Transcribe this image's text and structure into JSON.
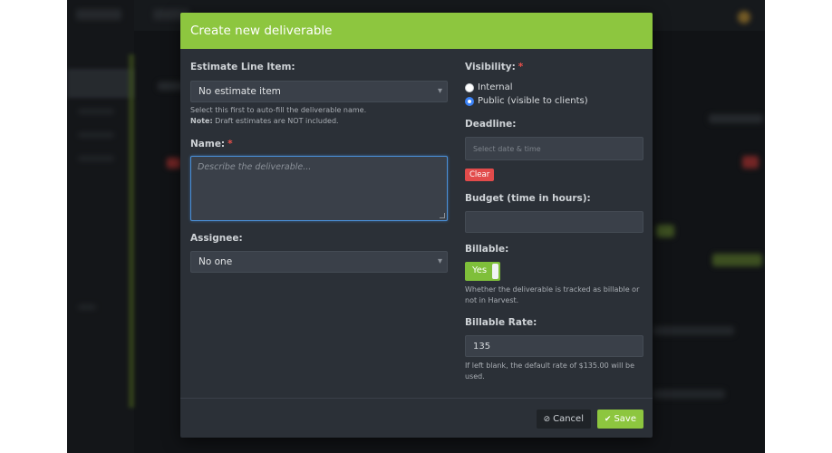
{
  "modal": {
    "title": "Create new deliverable"
  },
  "left": {
    "estimate_label": "Estimate Line Item:",
    "estimate_value": "No estimate item",
    "estimate_help": "Select this first to auto-fill the deliverable name.",
    "estimate_note_strong": "Note:",
    "estimate_note": " Draft estimates are NOT included.",
    "name_label": "Name:",
    "name_required": "*",
    "name_placeholder": "Describe the deliverable...",
    "assignee_label": "Assignee:",
    "assignee_value": "No one"
  },
  "right": {
    "visibility_label": "Visibility:",
    "visibility_required": "*",
    "visibility_options": [
      "Internal",
      "Public (visible to clients)"
    ],
    "visibility_selected": "Public (visible to clients)",
    "deadline_label": "Deadline:",
    "deadline_placeholder": "Select date & time",
    "clear_label": "Clear",
    "budget_label": "Budget (time in hours):",
    "budget_value": "",
    "billable_label": "Billable:",
    "billable_value": "Yes",
    "billable_help": "Whether the deliverable is tracked as billable or not in Harvest.",
    "rate_label": "Billable Rate:",
    "rate_value": "135",
    "rate_help": "If left blank, the default rate of $135.00 will be used."
  },
  "footer": {
    "cancel_label": "Cancel",
    "save_label": "Save"
  },
  "icons": {
    "cancel": "ban-icon",
    "save": "check-icon",
    "select_caret": "caret-down-icon"
  },
  "colors": {
    "accent": "#8dc63f",
    "danger": "#e24b4b",
    "focus": "#4a90d9",
    "modal_bg": "#2b3037"
  }
}
